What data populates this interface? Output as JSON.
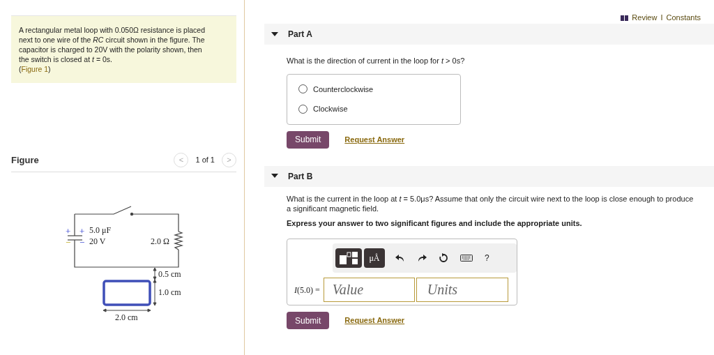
{
  "intro": {
    "text": "A rectangular metal loop with 0.050Ω resistance is placed next to one wire of the *RC* circuit shown in the figure. The capacitor is charged to 20V with the polarity shown, then the switch is closed at *t* = 0s.",
    "link": "Figure 1",
    "link_open": "(",
    "link_close": ")"
  },
  "figure": {
    "title": "Figure",
    "pager": "1 of 1",
    "prev": "<",
    "next": ">",
    "labels": {
      "plus_outer": "+",
      "plus_inner": "+",
      "minus_outer": "−",
      "minus_inner": "−",
      "capacitance": "5.0 μF",
      "voltage": "20 V",
      "resistance": "2.0 Ω",
      "gap": "0.5 cm",
      "height": "1.0 cm",
      "width": "2.0 cm"
    }
  },
  "header": {
    "review": "Review",
    "separator": "I",
    "constants": "Constants"
  },
  "parts": [
    {
      "kind": "choice",
      "title": "Part A",
      "expanded": true,
      "question": "What is the direction of current in the loop for *t* > 0s?",
      "options": [
        {
          "label": "Counterclockwise",
          "selected": false
        },
        {
          "label": "Clockwise",
          "selected": false
        }
      ],
      "submit": "Submit",
      "request": "Request Answer"
    },
    {
      "kind": "answer",
      "title": "Part B",
      "expanded": true,
      "question": "What is the current in the loop at *t* = 5.0μs? Assume that only the circuit wire next to the loop is close enough to produce a significant magnetic field.",
      "instruction": "Express your answer to two significant figures and include the appropriate units.",
      "toolbar": {
        "units": "μÅ",
        "help": "?"
      },
      "equation": "*I*(5.0) =",
      "value_placeholder": "Value",
      "units_placeholder": "Units",
      "submit": "Submit",
      "request": "Request Answer"
    }
  ]
}
